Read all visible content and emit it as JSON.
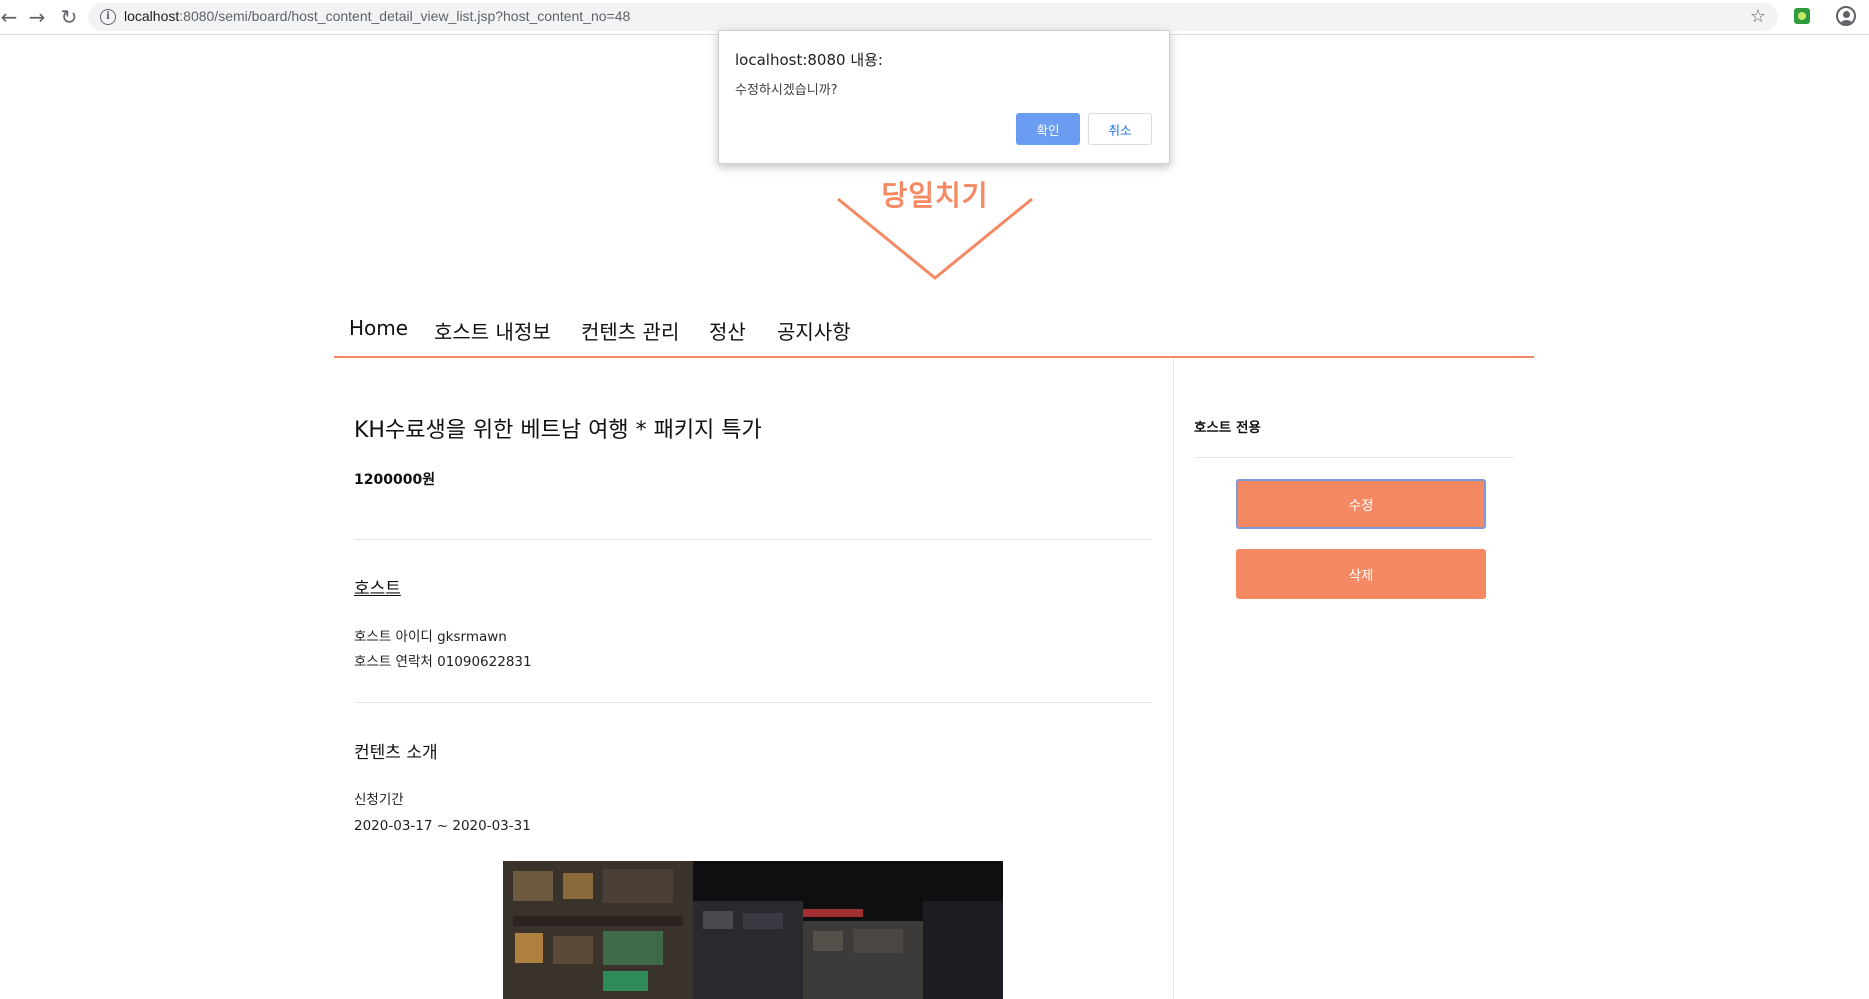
{
  "browser": {
    "url_host": "localhost",
    "url_rest": ":8080/semi/board/host_content_detail_view_list.jsp?host_content_no=48"
  },
  "logo": {
    "text": "당일치기",
    "color": "#f48963"
  },
  "nav": {
    "items": [
      {
        "label": "Home"
      },
      {
        "label": "호스트 내정보"
      },
      {
        "label": "컨텐츠 관리"
      },
      {
        "label": "정산"
      },
      {
        "label": "공지사항"
      }
    ]
  },
  "content": {
    "title": "KH수료생을 위한 베트남 여행 * 패키지 특가",
    "price": "1200000원",
    "host_section": {
      "heading": "호스트",
      "host_id": "호스트 아이디 gksrmawn",
      "host_contact": "호스트 연락처 01090622831"
    },
    "intro_section": {
      "heading": "컨텐츠 소개",
      "period_label": "신청기간",
      "period_value": "2020-03-17 ~ 2020-03-31"
    }
  },
  "sidebar": {
    "title": "호스트 전용",
    "edit_label": "수정",
    "delete_label": "삭제"
  },
  "dialog": {
    "title": "localhost:8080 내용:",
    "message": "수정하시겠습니까?",
    "ok_label": "확인",
    "cancel_label": "취소"
  },
  "colors": {
    "accent": "#f48963",
    "dialog_ok": "#6a9cf2"
  }
}
